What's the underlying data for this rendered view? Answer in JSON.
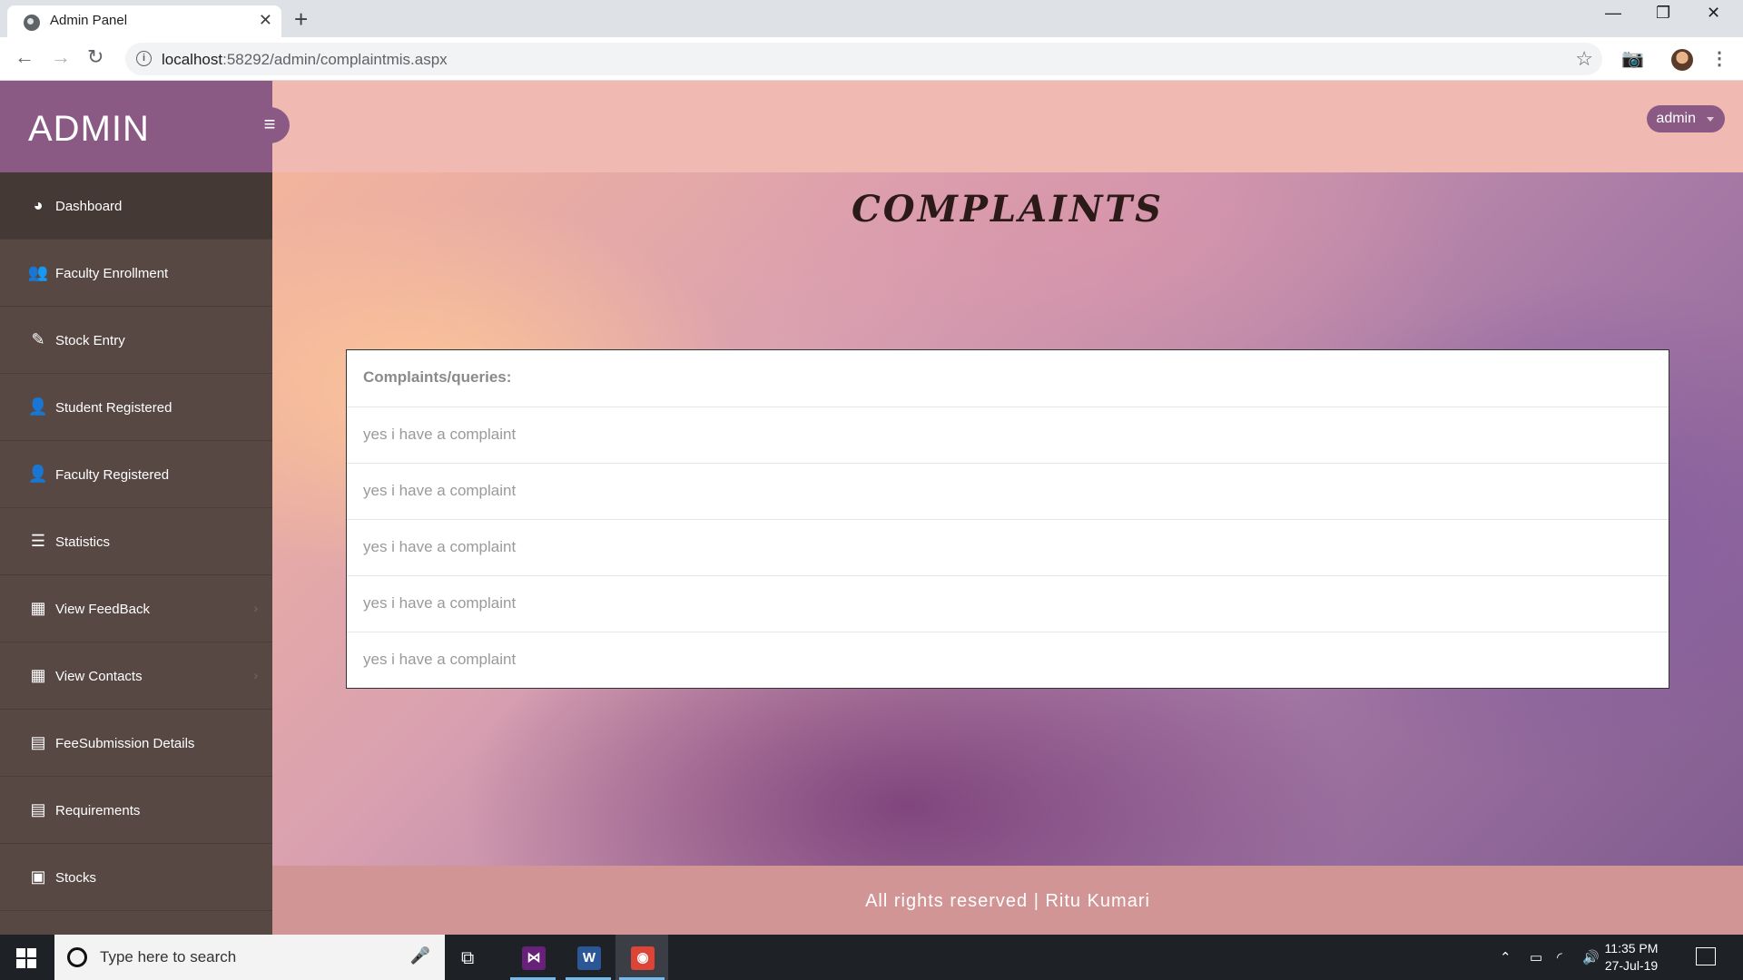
{
  "browser": {
    "tab_title": "Admin Panel",
    "tab_close": "✕",
    "new_tab": "+",
    "url_host": "localhost",
    "url_rest": ":58292/admin/complaintmis.aspx",
    "window": {
      "minimize": "—",
      "restore": "❐",
      "close": "✕"
    }
  },
  "app": {
    "brand": "ADMIN",
    "user_menu": "admin",
    "page_title": "COMPLAINTS",
    "sidebar": {
      "items": [
        {
          "label": "Dashboard",
          "icon": "dashboard-icon",
          "glyph": "◕",
          "active": true,
          "chevron": false
        },
        {
          "label": "Faculty Enrollment",
          "icon": "users-icon",
          "glyph": "👥",
          "active": false,
          "chevron": false
        },
        {
          "label": "Stock Entry",
          "icon": "edit-icon",
          "glyph": "✎",
          "active": false,
          "chevron": false
        },
        {
          "label": "Student Registered",
          "icon": "user-icon",
          "glyph": "👤",
          "active": false,
          "chevron": false
        },
        {
          "label": "Faculty Registered",
          "icon": "user-plus-icon",
          "glyph": "👤",
          "active": false,
          "chevron": false
        },
        {
          "label": "Statistics",
          "icon": "list-icon",
          "glyph": "☰",
          "active": false,
          "chevron": false
        },
        {
          "label": "View FeedBack",
          "icon": "grid-icon",
          "glyph": "▦",
          "active": false,
          "chevron": true
        },
        {
          "label": "View Contacts",
          "icon": "grid-icon",
          "glyph": "▦",
          "active": false,
          "chevron": true
        },
        {
          "label": "FeeSubmission Details",
          "icon": "book-icon",
          "glyph": "▤",
          "active": false,
          "chevron": false
        },
        {
          "label": "Requirements",
          "icon": "tasks-icon",
          "glyph": "▤",
          "active": false,
          "chevron": false
        },
        {
          "label": "Stocks",
          "icon": "briefcase-icon",
          "glyph": "▣",
          "active": false,
          "chevron": false
        }
      ]
    },
    "complaints": {
      "header": "Complaints/queries:",
      "rows": [
        "yes i have a complaint",
        "yes i have a complaint",
        "yes i have a complaint",
        "yes i have a complaint",
        "yes i have a complaint"
      ]
    },
    "footer": "All rights reserved | Ritu Kumari"
  },
  "taskbar": {
    "search_placeholder": "Type here to search",
    "time": "11:35 PM",
    "date": "27-Jul-19",
    "apps": [
      {
        "name": "visual-studio",
        "glyph": "⋈",
        "color": "#68217a",
        "running": true,
        "active": false
      },
      {
        "name": "word",
        "glyph": "W",
        "color": "#2b5797",
        "running": true,
        "active": false
      },
      {
        "name": "chrome",
        "glyph": "◉",
        "color": "#db4437",
        "running": true,
        "active": true
      }
    ]
  }
}
